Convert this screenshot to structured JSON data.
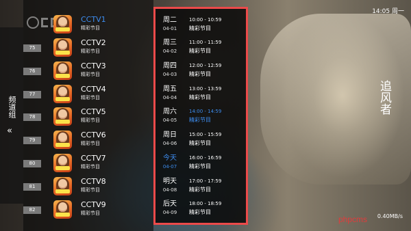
{
  "status_bar": {
    "clock": "14:05 周一",
    "net_speed": "0.40MB/s"
  },
  "side_tab": {
    "label": "频道组",
    "arrow": "«"
  },
  "channels": [
    {
      "num": "",
      "name": "CCTV1",
      "subtitle": "精彩节目",
      "active": true
    },
    {
      "num": "75",
      "name": "CCTV2",
      "subtitle": "精彩节目",
      "active": false
    },
    {
      "num": "76",
      "name": "CCTV3",
      "subtitle": "精彩节目",
      "active": false
    },
    {
      "num": "77",
      "name": "CCTV4",
      "subtitle": "精彩节目",
      "active": false
    },
    {
      "num": "78",
      "name": "CCTV5",
      "subtitle": "精彩节目",
      "active": false
    },
    {
      "num": "79",
      "name": "CCTV6",
      "subtitle": "精彩节目",
      "active": false
    },
    {
      "num": "80",
      "name": "CCTV7",
      "subtitle": "精彩节目",
      "active": false
    },
    {
      "num": "81",
      "name": "CCTV8",
      "subtitle": "精彩节目",
      "active": false
    },
    {
      "num": "82",
      "name": "CCTV9",
      "subtitle": "精彩节目",
      "active": false
    }
  ],
  "schedule": [
    {
      "day": "周二",
      "date": "04-01",
      "time": "10:00 - 10:59",
      "title": "精彩节目"
    },
    {
      "day": "周三",
      "date": "04-02",
      "time": "11:00 - 11:59",
      "title": "精彩节目"
    },
    {
      "day": "周四",
      "date": "04-03",
      "time": "12:00 - 12:59",
      "title": "精彩节目"
    },
    {
      "day": "周五",
      "date": "04-04",
      "time": "13:00 - 13:59",
      "title": "精彩节目"
    },
    {
      "day": "周六",
      "date": "04-05",
      "time": "14:00 - 14:59",
      "title": "精彩节目",
      "playing": true
    },
    {
      "day": "周日",
      "date": "04-06",
      "time": "15:00 - 15:59",
      "title": "精彩节目"
    },
    {
      "day": "今天",
      "date": "04-07",
      "time": "16:00 - 16:59",
      "title": "精彩节目",
      "today": true
    },
    {
      "day": "明天",
      "date": "04-08",
      "time": "17:00 - 17:59",
      "title": "精彩节目"
    },
    {
      "day": "后天",
      "date": "04-09",
      "time": "18:00 - 18:59",
      "title": "精彩节目"
    }
  ],
  "video": {
    "show_title": "追风者"
  },
  "overlay": {
    "site_mark": "phpcms"
  },
  "colors": {
    "accent": "#3d8df0",
    "highlight_border": "#ec4a4a",
    "number_badge": "#7a7a7a"
  },
  "icons": {
    "channel_thumbnail": "show-poster-icon",
    "channel_logo": "cctv-logo-icon"
  }
}
